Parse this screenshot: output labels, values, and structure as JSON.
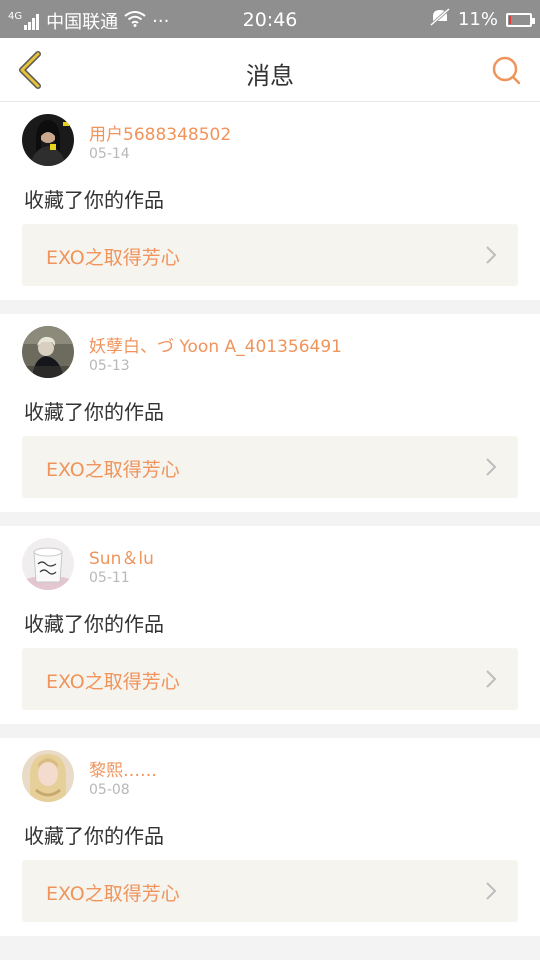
{
  "status_bar": {
    "network": "4G",
    "carrier": "中国联通",
    "more": "···",
    "time": "20:46",
    "battery": "11%",
    "battery_level": 0.11
  },
  "header": {
    "title": "消息"
  },
  "colors": {
    "accent": "#f0945c",
    "status_bar": "#8f8f8f",
    "battery_low": "#e33b3b"
  },
  "messages": [
    {
      "username": "用户5688348502",
      "date": "05-14",
      "action": "收藏了你的作品",
      "work_title": "EXO之取得芳心"
    },
    {
      "username": "妖孽白、づ Yoon A_401356491",
      "date": "05-13",
      "action": "收藏了你的作品",
      "work_title": "EXO之取得芳心"
    },
    {
      "username": "Sun＆lu",
      "date": "05-11",
      "action": "收藏了你的作品",
      "work_title": "EXO之取得芳心"
    },
    {
      "username": "黎熙……",
      "date": "05-08",
      "action": "收藏了你的作品",
      "work_title": "EXO之取得芳心"
    }
  ]
}
